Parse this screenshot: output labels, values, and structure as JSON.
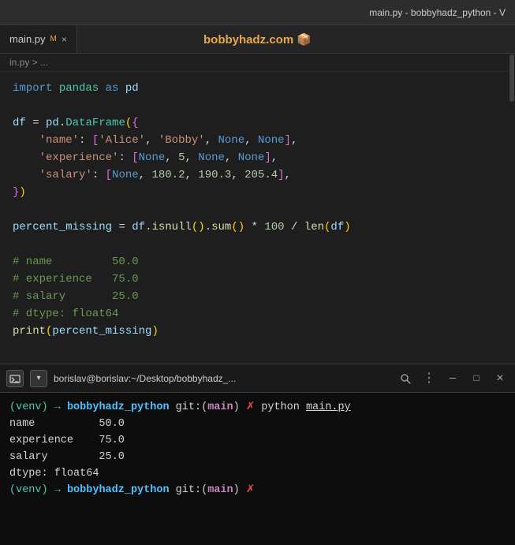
{
  "titleBar": {
    "text": "main.py - bobbyhadz_python - V"
  },
  "tabBar": {
    "siteName": "bobbyhadz.com 📦",
    "tab": {
      "name": "main.py",
      "marker": "M",
      "closeLabel": "×"
    }
  },
  "breadcrumb": {
    "text": "in.py > ..."
  },
  "code": {
    "lines": [
      {
        "id": "line1",
        "content": "import pandas as pd"
      },
      {
        "id": "line2",
        "content": ""
      },
      {
        "id": "line3",
        "content": "df = pd.DataFrame({"
      },
      {
        "id": "line4",
        "content": "    'name': ['Alice', 'Bobby', None, None],"
      },
      {
        "id": "line5",
        "content": "    'experience': [None, 5, None, None],"
      },
      {
        "id": "line6",
        "content": "    'salary': [None, 180.2, 190.3, 205.4],"
      },
      {
        "id": "line7",
        "content": "})"
      },
      {
        "id": "line8",
        "content": ""
      },
      {
        "id": "line9",
        "content": "percent_missing = df.isnull().sum() * 100 / len(df)"
      },
      {
        "id": "line10",
        "content": ""
      },
      {
        "id": "line11",
        "content": "# name         50.0"
      },
      {
        "id": "line12",
        "content": "# experience   75.0"
      },
      {
        "id": "line13",
        "content": "# salary       25.0"
      },
      {
        "id": "line14",
        "content": "# dtype: float64"
      },
      {
        "id": "line15",
        "content": "print(percent_missing)"
      }
    ]
  },
  "terminal": {
    "tabTitle": "borislav@borislav:~/Desktop/bobbyhadz_...",
    "icons": {
      "new": "+",
      "dropdown": "▾",
      "search": "🔍",
      "more": "⋮",
      "minimize": "—",
      "maximize": "□",
      "close": "×"
    },
    "lines": [
      {
        "id": "t1",
        "type": "prompt",
        "content": "(venv) → bobbyhadz_python git:(main) ✗ python main.py"
      },
      {
        "id": "t2",
        "type": "output",
        "content": "name          50.0"
      },
      {
        "id": "t3",
        "type": "output",
        "content": "experience    75.0"
      },
      {
        "id": "t4",
        "type": "output",
        "content": "salary        25.0"
      },
      {
        "id": "t5",
        "type": "output",
        "content": "dtype: float64"
      },
      {
        "id": "t6",
        "type": "prompt",
        "content": "(venv) → bobbyhadz_python git:(main) ✗"
      }
    ]
  }
}
